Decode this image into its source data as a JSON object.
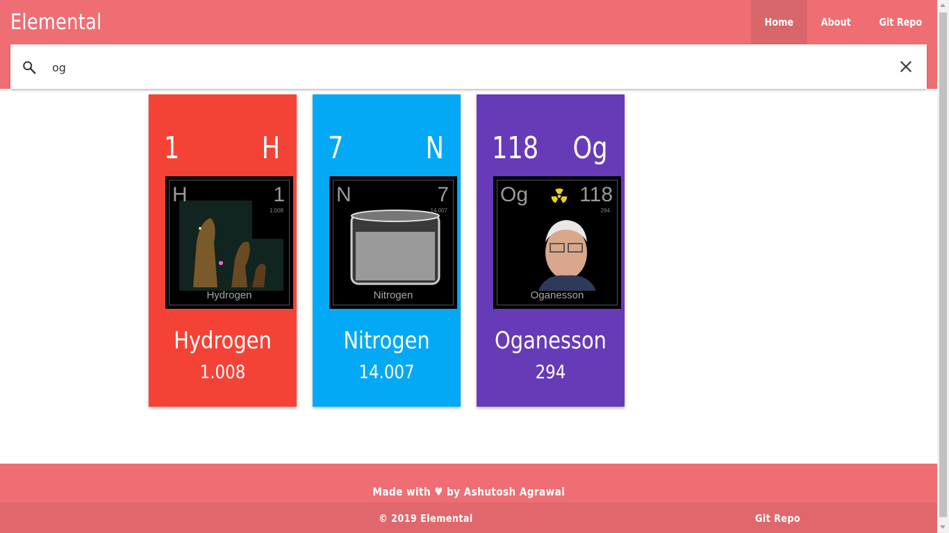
{
  "navbar": {
    "brand": "Elemental",
    "links": [
      {
        "label": "Home",
        "active": true
      },
      {
        "label": "About",
        "active": false
      },
      {
        "label": "Git Repo",
        "active": false
      }
    ],
    "color": "#ef6e73"
  },
  "search": {
    "value": "og",
    "icon": "search-icon",
    "clear_icon": "close-icon"
  },
  "cards": [
    {
      "number": "1",
      "symbol": "H",
      "name": "Hydrogen",
      "mass": "1.008",
      "color": "#f44336",
      "tile": {
        "symbol": "H",
        "number": "1",
        "mass": "1.008",
        "name": "Hydrogen"
      }
    },
    {
      "number": "7",
      "symbol": "N",
      "name": "Nitrogen",
      "mass": "14.007",
      "color": "#03a9f4",
      "tile": {
        "symbol": "N",
        "number": "7",
        "mass": "14.007",
        "name": "Nitrogen"
      }
    },
    {
      "number": "118",
      "symbol": "Og",
      "name": "Oganesson",
      "mass": "294",
      "color": "#673ab7",
      "tile": {
        "symbol": "Og",
        "number": "118",
        "mass": "294.",
        "name": "Oganesson"
      }
    }
  ],
  "footer": {
    "made_with": "Made with ♥ by Ashutosh Agrawal",
    "copyright": "© 2019 Elemental",
    "repo_link": "Git Repo"
  }
}
